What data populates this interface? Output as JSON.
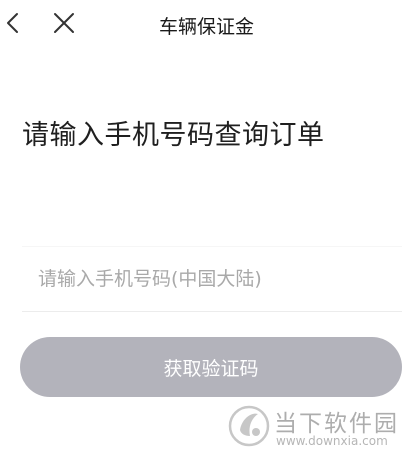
{
  "header": {
    "title": "车辆保证金",
    "back_icon": "chevron-left-icon",
    "close_icon": "close-icon"
  },
  "main": {
    "heading": "请输入手机号码查询订单",
    "phone_input": {
      "value": "",
      "placeholder": "请输入手机号码(中国大陆)"
    },
    "get_code_button": {
      "label": "获取验证码",
      "color": "#b3b3bb"
    }
  },
  "watermark": {
    "name": "当下软件园",
    "url": "www.downxia.com"
  }
}
